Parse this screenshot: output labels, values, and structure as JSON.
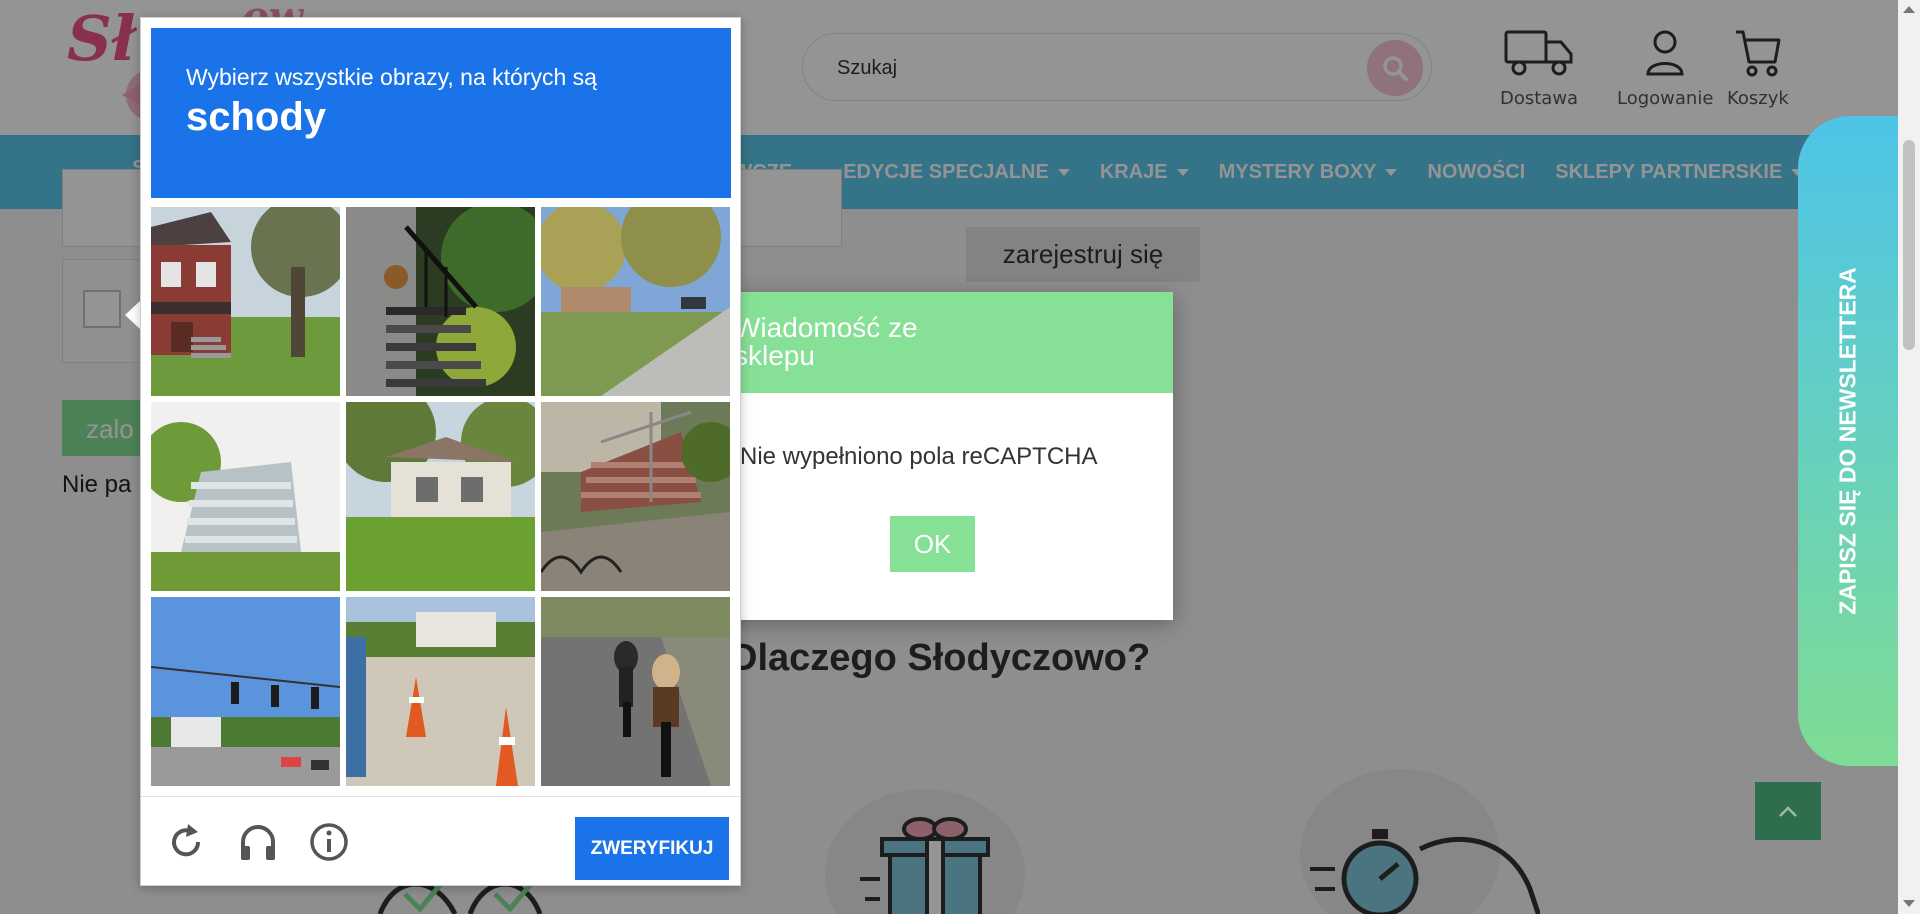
{
  "header": {
    "logo_text": "Słodyczowo",
    "search_placeholder": "Szukaj",
    "links": {
      "delivery": "Dostawa",
      "login": "Logowanie",
      "cart": "Koszyk"
    }
  },
  "nav": {
    "first_partial": "S",
    "items": [
      {
        "label": "YWCZE",
        "has_caret": true
      },
      {
        "label": "EDYCJE SPECJALNE",
        "has_caret": true
      },
      {
        "label": "KRAJE",
        "has_caret": true
      },
      {
        "label": "MYSTERY BOXY",
        "has_caret": true
      },
      {
        "label": "NOWOŚCI",
        "has_caret": false
      },
      {
        "label": "SKLEPY PARTNERSKIE",
        "has_caret": true
      }
    ]
  },
  "page": {
    "login_button_partial": "zalo",
    "forgot_partial": "Nie pa",
    "register_button": "zarejestruj się",
    "why_heading": "Dlaczego Słodyczowo?"
  },
  "message_modal": {
    "title": "Wiadomość ze sklepu",
    "title_line1": "Wiadomość ze",
    "title_line2": "sklepu",
    "message": "Nie wypełniono pola reCAPTCHA",
    "ok_button": "OK"
  },
  "newsletter": {
    "label": "ZAPISZ SIĘ DO NEWSLETTERA"
  },
  "recaptcha": {
    "instruction": "Wybierz wszystkie obrazy, na których są",
    "object": "schody",
    "verify_button": "ZWERYFIKUJ",
    "tiles": [
      "tile-red-brick-house-steps",
      "tile-dark-porch-stairs",
      "tile-suburban-street",
      "tile-white-concrete-stairs",
      "tile-white-house-lawn",
      "tile-outdoor-stone-stairs",
      "tile-intersection-traffic-lights",
      "tile-construction-cones",
      "tile-motorcycles-road"
    ],
    "icons": [
      "reload-icon",
      "headphones-icon",
      "info-icon"
    ]
  },
  "colors": {
    "brand_blue": "#1a73e8",
    "nav_blue": "#5bc6ea",
    "accent_green": "#86e095",
    "search_pink": "#f6c4d6"
  }
}
